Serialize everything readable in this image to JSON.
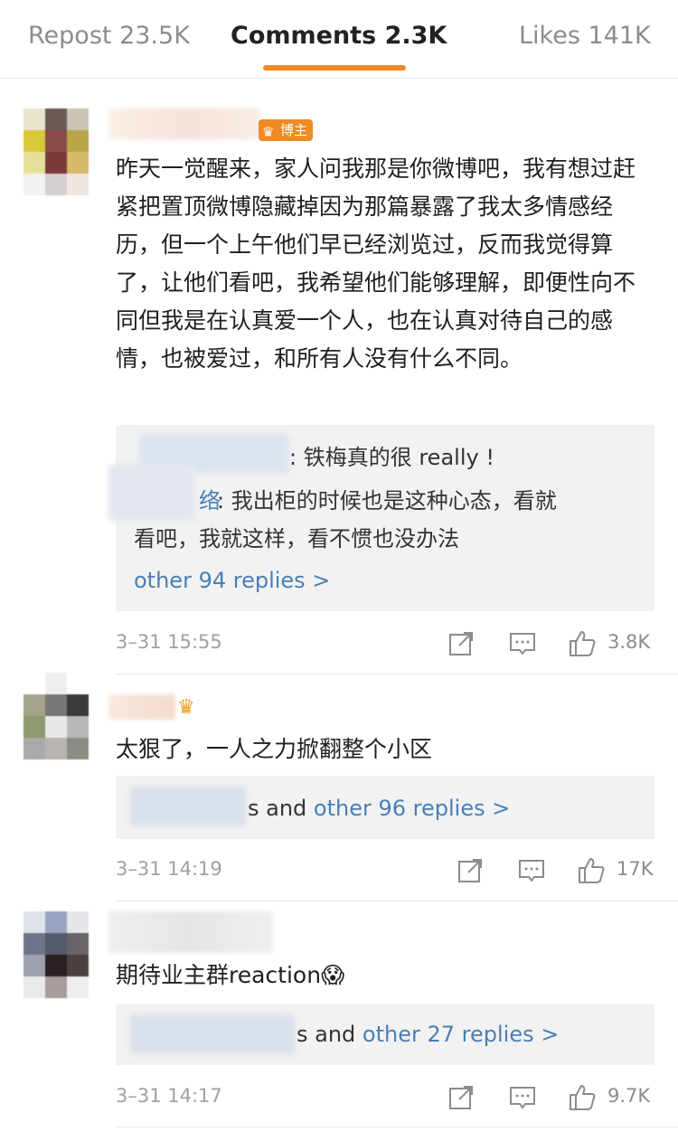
{
  "colors": {
    "accent": "#f08a24",
    "link": "#4a7fb5",
    "badge_orange": "#f08a24"
  },
  "tabs": [
    {
      "label": "Repost",
      "count": "23.5K"
    },
    {
      "label": "Comments",
      "count": "2.3K"
    },
    {
      "label": "Likes",
      "count": "141K"
    }
  ],
  "comments": [
    {
      "badge": "博主",
      "text": "昨天一觉醒来，家人问我那是你微博吧，我有想过赶紧把置顶微博隐藏掉因为那篇暴露了我太多情感经历，但一个上午他们早已经浏览过，反而我觉得算了，让他们看吧，我希望他们能够理解，即便性向不同但我是在认真爱一个人，也在认真对待自己的感情，也被爱过，和所有人没有什么不同。",
      "replies": [
        {
          "prefix": "",
          "text": ": 铁梅真的很 really !"
        },
        {
          "prefix": "络",
          "text": ": 我出柜的时候也是这种心态，看就"
        },
        {
          "prefix": "",
          "text": "看吧，我就这样，看不惯也没办法"
        }
      ],
      "more": "other 94 replies >",
      "time": "3–31 15:55",
      "likes": "3.8K"
    },
    {
      "text": "太狠了，一人之力掀翻整个小区",
      "reply_suffix": "s and ",
      "more": "other 96 replies >",
      "time": "3–31 14:19",
      "likes": "17K"
    },
    {
      "text": "期待业主群reaction😱",
      "reply_suffix": "s and ",
      "more": "other 27 replies >",
      "time": "3–31 14:17",
      "likes": "9.7K"
    }
  ],
  "icons": {
    "repost": "repost-icon",
    "comment": "comment-icon",
    "like": "thumbs-up-icon"
  }
}
